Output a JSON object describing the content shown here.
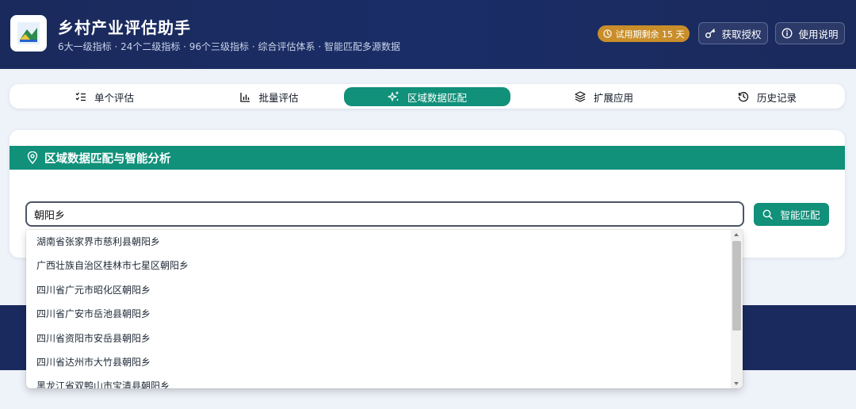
{
  "header": {
    "title": "乡村产业评估助手",
    "subtitle": "6大一级指标 · 24个二级指标 · 96个三级指标 · 综合评估体系 · 智能匹配多源数据",
    "trial_badge": "试用期剩余 15 天",
    "license_button": "获取授权",
    "help_button": "使用说明"
  },
  "tabs": [
    {
      "label": "单个评估",
      "icon": "checklist-icon",
      "active": false
    },
    {
      "label": "批量评估",
      "icon": "bar-chart-icon",
      "active": false
    },
    {
      "label": "区域数据匹配",
      "icon": "sparkle-icon",
      "active": true
    },
    {
      "label": "扩展应用",
      "icon": "layers-icon",
      "active": false
    },
    {
      "label": "历史记录",
      "icon": "history-icon",
      "active": false
    }
  ],
  "card": {
    "title": "区域数据匹配与智能分析",
    "search_value": "朝阳乡",
    "match_button": "智能匹配"
  },
  "dropdown": {
    "items": [
      "湖南省张家界市慈利县朝阳乡",
      "广西壮族自治区桂林市七星区朝阳乡",
      "四川省广元市昭化区朝阳乡",
      "四川省广安市岳池县朝阳乡",
      "四川省资阳市安岳县朝阳乡",
      "四川省达州市大竹县朝阳乡",
      "黑龙江省双鸭山市宝清县朝阳乡"
    ]
  },
  "colors": {
    "brand_dark": "#1b2a5c",
    "accent_green": "#11907a",
    "trial_gold": "#c98e2a"
  }
}
